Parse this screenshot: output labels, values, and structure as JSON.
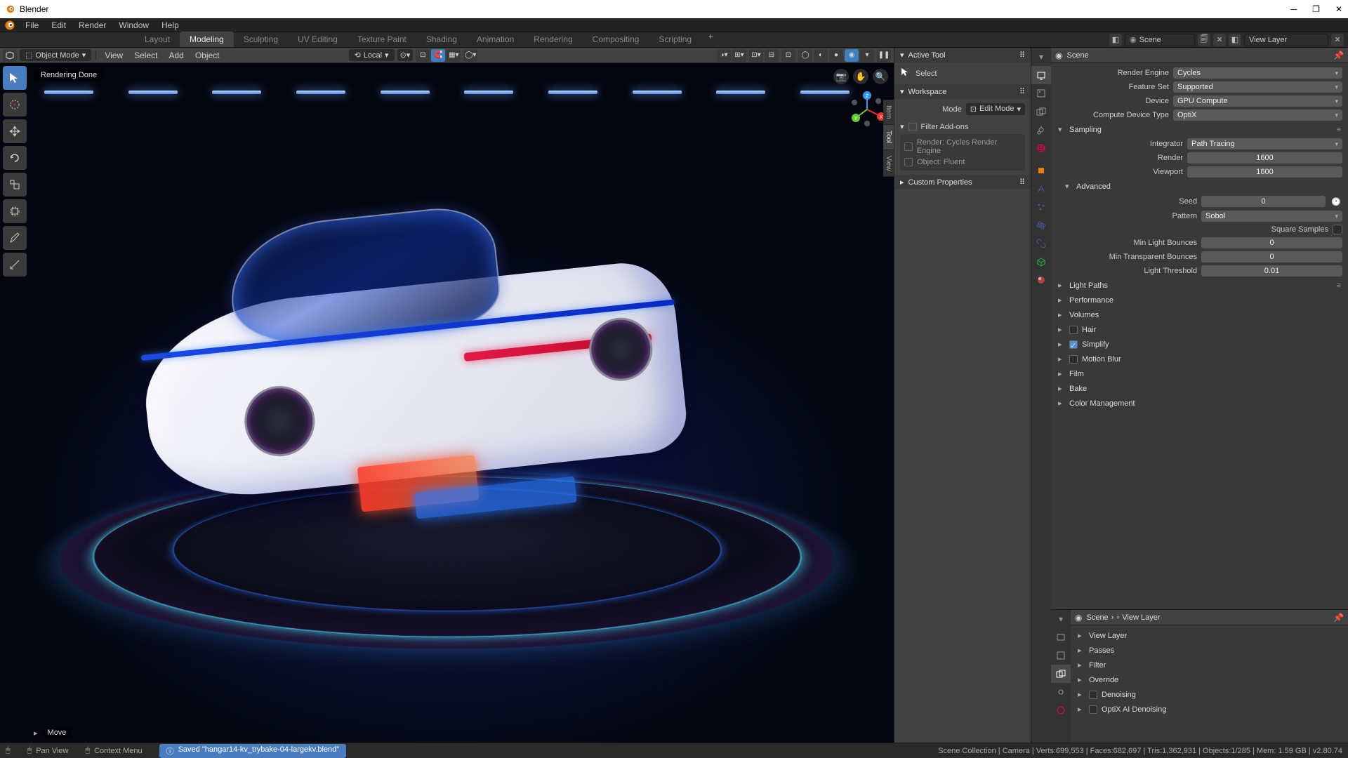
{
  "app": {
    "title": "Blender"
  },
  "menu": [
    "File",
    "Edit",
    "Render",
    "Window",
    "Help"
  ],
  "workspaces": {
    "tabs": [
      "Layout",
      "Modeling",
      "Sculpting",
      "UV Editing",
      "Texture Paint",
      "Shading",
      "Animation",
      "Rendering",
      "Compositing",
      "Scripting"
    ],
    "active": 1
  },
  "topright": {
    "scene": "Scene",
    "view_layer": "View Layer"
  },
  "vpheader": {
    "mode": "Object Mode",
    "menus": [
      "View",
      "Select",
      "Add",
      "Object"
    ],
    "orient": "Local"
  },
  "viewport": {
    "status": "Rendering Done",
    "footer_action": "Move"
  },
  "npanel": {
    "side_tabs": [
      "Item",
      "Tool",
      "View"
    ],
    "active_tool": {
      "header": "Active Tool",
      "label": "Select"
    },
    "workspace": {
      "header": "Workspace",
      "mode_label": "Mode",
      "mode_value": "Edit Mode",
      "filter": "Filter Add-ons",
      "addon1": "Render: Cycles Render Engine",
      "addon2": "Object: Fluent"
    },
    "custom": "Custom Properties"
  },
  "props_upper": {
    "crumb": "Scene",
    "engine": {
      "label": "Render Engine",
      "value": "Cycles"
    },
    "feature": {
      "label": "Feature Set",
      "value": "Supported"
    },
    "device": {
      "label": "Device",
      "value": "GPU Compute"
    },
    "cdt": {
      "label": "Compute Device Type",
      "value": "OptiX"
    },
    "sampling": {
      "header": "Sampling",
      "integrator_l": "Integrator",
      "integrator": "Path Tracing",
      "render_l": "Render",
      "render": "1600",
      "viewport_l": "Viewport",
      "viewport": "1600"
    },
    "advanced": {
      "header": "Advanced",
      "seed_l": "Seed",
      "seed": "0",
      "pattern_l": "Pattern",
      "pattern": "Sobol",
      "square": "Square Samples",
      "mlb_l": "Min Light Bounces",
      "mlb": "0",
      "mtb_l": "Min Transparent Bounces",
      "mtb": "0",
      "lt_l": "Light Threshold",
      "lt": "0.01"
    },
    "sections": [
      "Light Paths",
      "Performance",
      "Volumes",
      "Hair",
      "Simplify",
      "Motion Blur",
      "Film",
      "Bake",
      "Color Management"
    ]
  },
  "props_lower": {
    "crumb1": "Scene",
    "crumb2": "View Layer",
    "sections": [
      "View Layer",
      "Passes",
      "Filter",
      "Override",
      "Denoising",
      "OptiX AI Denoising"
    ]
  },
  "status": {
    "left1": "Pan View",
    "left2": "Context Menu",
    "saved": "Saved \"hangar14-kv_trybake-04-largekv.blend\"",
    "stats": "Scene Collection | Camera | Verts:699,553 | Faces:682,697 | Tris:1,362,931 | Objects:1/285 | Mem: 1.59 GB | v2.80.74"
  }
}
